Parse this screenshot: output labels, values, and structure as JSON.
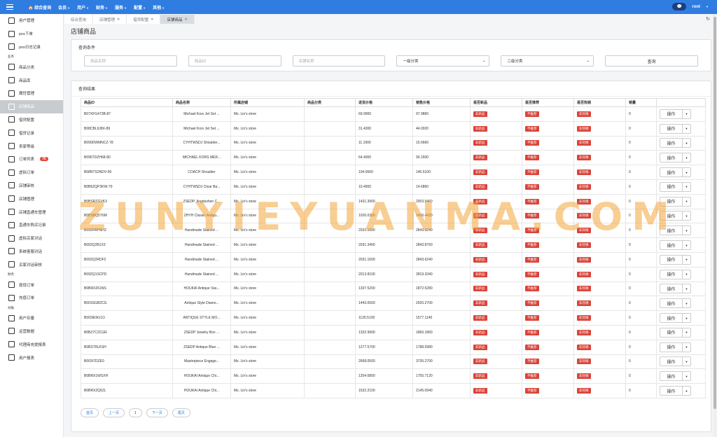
{
  "topnav": {
    "home": "综合查询",
    "items": [
      "会员",
      "用户",
      "财务",
      "服务",
      "配置",
      "其他"
    ]
  },
  "user": {
    "name": "root"
  },
  "sidebar": {
    "items": [
      {
        "label": "用户管理"
      },
      {
        "label": "pos下单"
      },
      {
        "label": "pos日志记录"
      },
      {
        "group": "业务"
      },
      {
        "label": "商品分类"
      },
      {
        "label": "商品库"
      },
      {
        "label": "属性管理"
      },
      {
        "label": "店铺商品",
        "active": true
      },
      {
        "label": "借贷配置"
      },
      {
        "label": "借贷记录"
      },
      {
        "label": "卖家等级"
      },
      {
        "label": "订单列表",
        "badge": "70"
      },
      {
        "label": "虚拟订单"
      },
      {
        "label": "店铺审核"
      },
      {
        "label": "店铺管理"
      },
      {
        "label": "店铺直通车管理"
      },
      {
        "label": "直通车购买记录"
      },
      {
        "label": "虚拟买家对话"
      },
      {
        "label": "系统客服对话"
      },
      {
        "label": "买家对话审核"
      },
      {
        "group": "财务"
      },
      {
        "label": "提现订单"
      },
      {
        "label": "充值订单"
      },
      {
        "group": "对账"
      },
      {
        "label": "用户存量"
      },
      {
        "label": "运营数据"
      },
      {
        "label": "代理商充提报表"
      },
      {
        "label": "用户报表"
      }
    ]
  },
  "tabs": [
    {
      "label": "综合查询",
      "closable": false
    },
    {
      "label": "店铺管理",
      "closable": true
    },
    {
      "label": "借贷配置",
      "closable": true
    },
    {
      "label": "店铺商品",
      "closable": true,
      "active": true
    }
  ],
  "page": {
    "title": "店铺商品"
  },
  "query": {
    "title": "查询条件",
    "product_name_placeholder": "商品名称",
    "product_id_placeholder": "商品ID",
    "store_name_placeholder": "店铺名称",
    "category1": "一级分类",
    "category2": "二级分类",
    "search_button": "查询"
  },
  "result": {
    "title": "查询结果",
    "columns": [
      "商品ID",
      "商品名称",
      "所属店铺",
      "商品分类",
      "进货价格",
      "销售价格",
      "是否新品",
      "是否推荐",
      "是否热销",
      "销量",
      ""
    ],
    "tag_new": "非新品",
    "tag_rec": "不推荐",
    "tag_hot": "非热销",
    "op_label": "操作",
    "rows": [
      {
        "id": "B07XFG473B-87",
        "name": "Michael Kors Jet Set ...",
        "store": "Ms. Lin's store",
        "cat": "",
        "cost": "69.9900",
        "price": "97.9860",
        "sales": "0"
      },
      {
        "id": "B08CBL9J8X-89",
        "name": "Michael Kors Jet Set ...",
        "store": "Ms. Lin's store",
        "cat": "",
        "cost": "31.4300",
        "price": "44.0020",
        "sales": "0"
      },
      {
        "id": "B099DWMNCZ-78",
        "name": "CYHTWSDJ Shoulder...",
        "store": "Ms. Lin's store",
        "cat": "",
        "cost": "11.1900",
        "price": "15.6660",
        "sales": "0"
      },
      {
        "id": "B096TDZH68-80",
        "name": "MICHAEL KORS MER...",
        "store": "Ms. Lin's store",
        "cat": "",
        "cost": "64.4000",
        "price": "90.1600",
        "sales": "0"
      },
      {
        "id": "B08NTS2NDV-99",
        "name": "COACH Shoulder",
        "store": "Ms. Lin's store",
        "cat": "",
        "cost": "104.6500",
        "price": "146.5100",
        "sales": "0"
      },
      {
        "id": "B0B6ZQP3KW-79",
        "name": "CYHTWSDJ Clear Ba...",
        "store": "Ms. Lin's store",
        "cat": "",
        "cost": "10.4900",
        "price": "14.6860",
        "sales": "0"
      },
      {
        "id": "B0BSRZGVK3",
        "name": "ZSEDP Jingdezhen C...",
        "store": "Ms. Lin's store",
        "cat": "",
        "cost": "1431.3900",
        "price": "2003.9460",
        "sales": "0"
      },
      {
        "id": "B0BSBQ5T6M",
        "name": "ZHYH Classic Antiqu...",
        "store": "Ms. Lin's store",
        "cat": "",
        "cost": "1026.0300",
        "price": "1436.4420",
        "sales": "0"
      },
      {
        "id": "B092FRPNH3",
        "name": "Handmade Stained ...",
        "store": "Ms. Lin's store",
        "cat": "",
        "cost": "2031.1600",
        "price": "2843.6240",
        "sales": "0"
      },
      {
        "id": "B092Q2B1X3",
        "name": "Handmade Stained ...",
        "store": "Ms. Lin's store",
        "cat": "",
        "cost": "2031.3400",
        "price": "2843.8760",
        "sales": "0"
      },
      {
        "id": "B092Q2RDF2",
        "name": "Handmade Stained ...",
        "store": "Ms. Lin's store",
        "cat": "",
        "cost": "2031.1600",
        "price": "2843.6240",
        "sales": "0"
      },
      {
        "id": "B092Q1SCPD",
        "name": "Handmade Stained ...",
        "store": "Ms. Lin's store",
        "cat": "",
        "cost": "2013.8100",
        "price": "2819.3340",
        "sales": "0"
      },
      {
        "id": "B0BRX261NS",
        "name": "HOUKAI Antique Vas...",
        "store": "Ms. Lin's store",
        "cat": "",
        "cost": "1337.5200",
        "price": "1872.5280",
        "sales": "0"
      },
      {
        "id": "B003SGB2CG",
        "name": "Antique Style Diamo...",
        "store": "Ms. Lin's store",
        "cat": "",
        "cost": "1443.0500",
        "price": "2020.2700",
        "sales": "0"
      },
      {
        "id": "B003IE9G1O",
        "name": "ANTIQUE STYLE MO...",
        "store": "Ms. Lin's store",
        "cat": "",
        "cost": "1126.5100",
        "price": "1577.1140",
        "sales": "0"
      },
      {
        "id": "B0BZ7C2CGR",
        "name": "ZSEDP Jewelry Box ...",
        "store": "Ms. Lin's store",
        "cat": "",
        "cost": "1332.9900",
        "price": "1866.1860",
        "sales": "0"
      },
      {
        "id": "B0BST8LKSH",
        "name": "ZSEDP Antique Blue ...",
        "store": "Ms. Lin's store",
        "cat": "",
        "cost": "1277.5700",
        "price": "1788.5980",
        "sales": "0"
      },
      {
        "id": "B003I7DZE0",
        "name": "Masterpiece Engage...",
        "store": "Ms. Lin's store",
        "cat": "",
        "cost": "2668.0500",
        "price": "3735.2700",
        "sales": "0"
      },
      {
        "id": "B0BRX1WSXH",
        "name": "HOUKAI Antique Chi...",
        "store": "Ms. Lin's store",
        "cat": "",
        "cost": "1254.0800",
        "price": "1755.7120",
        "sales": "0"
      },
      {
        "id": "B0BRX2Q52L",
        "name": "HOUKAI Antique Chi...",
        "store": "Ms. Lin's store",
        "cat": "",
        "cost": "1532.2100",
        "price": "2145.0940",
        "sales": "0"
      }
    ]
  },
  "pager": {
    "first": "首页",
    "prev": "上一页",
    "current": "1",
    "next": "下一页",
    "last": "尾页"
  },
  "watermark": "ZUNYIEYUANMA.COM",
  "colors": {
    "accent": "#2f7de1",
    "danger": "#d9443a",
    "watermark": "#f2a63a"
  }
}
